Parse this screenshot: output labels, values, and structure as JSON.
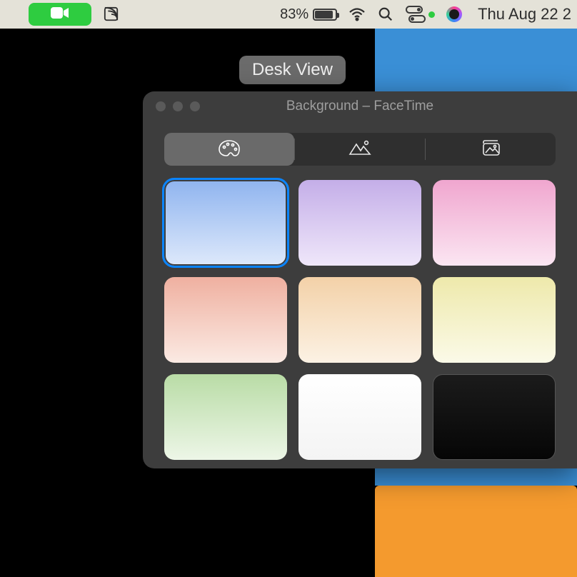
{
  "menubar": {
    "battery_percent": "83%",
    "date_time": "Thu Aug 22  2"
  },
  "desk_view_label": "Desk View",
  "window": {
    "title": "Background – FaceTime",
    "tabs": {
      "colors": "Colors",
      "wallpapers": "Wallpapers",
      "photos": "Photos",
      "selected": "colors"
    },
    "swatches": [
      {
        "name": "blue",
        "gradient_top": "#8fb4ef",
        "gradient_bottom": "#dee9fb",
        "selected": true
      },
      {
        "name": "purple",
        "gradient_top": "#c4aee8",
        "gradient_bottom": "#efe7fa",
        "selected": false
      },
      {
        "name": "pink",
        "gradient_top": "#f0a6cf",
        "gradient_bottom": "#fbe6f2",
        "selected": false
      },
      {
        "name": "coral",
        "gradient_top": "#efb0a0",
        "gradient_bottom": "#fbeae3",
        "selected": false
      },
      {
        "name": "peach",
        "gradient_top": "#f3d1a8",
        "gradient_bottom": "#fcf2e4",
        "selected": false
      },
      {
        "name": "yellow",
        "gradient_top": "#eee9ab",
        "gradient_bottom": "#fbfae8",
        "selected": false
      },
      {
        "name": "green",
        "gradient_top": "#b9dca6",
        "gradient_bottom": "#edf6e7",
        "selected": false
      },
      {
        "name": "white",
        "gradient_top": "#ffffff",
        "gradient_bottom": "#f4f4f4",
        "selected": false
      },
      {
        "name": "black",
        "gradient_top": "#1b1b1b",
        "gradient_bottom": "#060606",
        "selected": false
      }
    ]
  }
}
